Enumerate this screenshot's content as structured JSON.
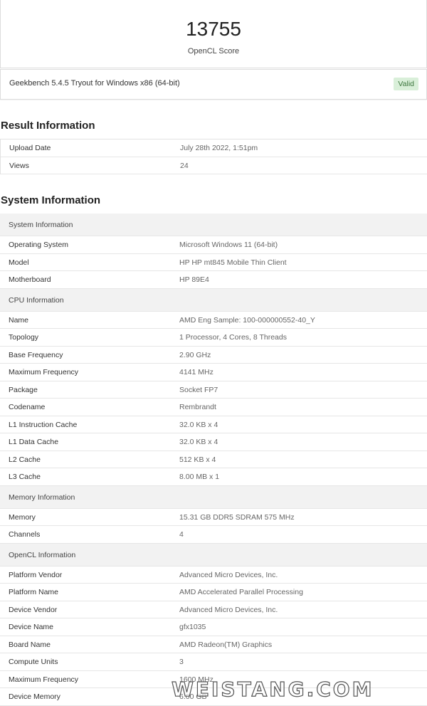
{
  "score": {
    "value": "13755",
    "label": "OpenCL Score"
  },
  "version": {
    "text": "Geekbench 5.4.5 Tryout for Windows x86 (64-bit)",
    "badge": "Valid"
  },
  "result_info": {
    "title": "Result Information",
    "rows": [
      {
        "key": "Upload Date",
        "value": "July 28th 2022, 1:51pm"
      },
      {
        "key": "Views",
        "value": "24"
      }
    ]
  },
  "system_info": {
    "title": "System Information",
    "groups": [
      {
        "header": "System Information",
        "rows": [
          {
            "key": "Operating System",
            "value": "Microsoft Windows 11 (64-bit)"
          },
          {
            "key": "Model",
            "value": "HP HP mt845 Mobile Thin Client"
          },
          {
            "key": "Motherboard",
            "value": "HP 89E4"
          }
        ]
      },
      {
        "header": "CPU Information",
        "rows": [
          {
            "key": "Name",
            "value": "AMD Eng Sample: 100-000000552-40_Y"
          },
          {
            "key": "Topology",
            "value": "1 Processor, 4 Cores, 8 Threads"
          },
          {
            "key": "Base Frequency",
            "value": "2.90 GHz"
          },
          {
            "key": "Maximum Frequency",
            "value": "4141 MHz"
          },
          {
            "key": "Package",
            "value": "Socket FP7"
          },
          {
            "key": "Codename",
            "value": "Rembrandt"
          },
          {
            "key": "L1 Instruction Cache",
            "value": "32.0 KB x 4"
          },
          {
            "key": "L1 Data Cache",
            "value": "32.0 KB x 4"
          },
          {
            "key": "L2 Cache",
            "value": "512 KB x 4"
          },
          {
            "key": "L3 Cache",
            "value": "8.00 MB x 1"
          }
        ]
      },
      {
        "header": "Memory Information",
        "rows": [
          {
            "key": "Memory",
            "value": "15.31 GB DDR5 SDRAM 575 MHz"
          },
          {
            "key": "Channels",
            "value": "4"
          }
        ]
      },
      {
        "header": "OpenCL Information",
        "rows": [
          {
            "key": "Platform Vendor",
            "value": "Advanced Micro Devices, Inc."
          },
          {
            "key": "Platform Name",
            "value": "AMD Accelerated Parallel Processing"
          },
          {
            "key": "Device Vendor",
            "value": "Advanced Micro Devices, Inc."
          },
          {
            "key": "Device Name",
            "value": "gfx1035"
          },
          {
            "key": "Board Name",
            "value": "AMD Radeon(TM) Graphics"
          },
          {
            "key": "Compute Units",
            "value": "3"
          },
          {
            "key": "Maximum Frequency",
            "value": "1600 MHz"
          },
          {
            "key": "Device Memory",
            "value": "6.00 GB"
          }
        ]
      }
    ]
  },
  "watermark": "WEISTANG.COM"
}
